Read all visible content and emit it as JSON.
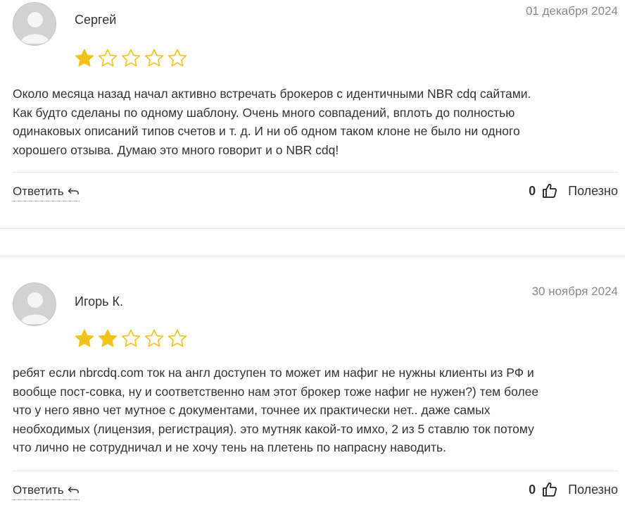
{
  "reviews": [
    {
      "author": "Сергей",
      "date": "01 декабря 2024",
      "rating": 1,
      "max_rating": 5,
      "lines": [
        "Около месяца назад начал активно встречать брокеров с идентичными NBR cdq сайтами.",
        "Как будто сделаны по одному шаблону. Очень много совпадений, вплоть до полностью",
        "одинаковых описаний типов счетов и т. д. И ни об одном таком клоне не было ни одного",
        "хорошего отзыва. Думаю это много говорит и о NBR cdq!"
      ],
      "reply_label": "Ответить",
      "helpful_count": "0",
      "helpful_label": "Полезно"
    },
    {
      "author": "Игорь К.",
      "date": "30 ноября 2024",
      "rating": 2,
      "max_rating": 5,
      "lines": [
        "ребят если nbrcdq.com ток на англ доступен то может им нафиг не нужны клиенты из РФ и",
        "вообще пост-совка, ну и соответственно нам этот брокер тоже нафиг не нужен?) тем более",
        "что у него явно чет мутное с документами, точнее их практически нет.. даже самых",
        "необходимых (лицензия, регистрация). это мутняк какой-то имхо, 2 из 5 ставлю ток потому",
        "что лично не сотрудничал и не хочу тень на плетень по напрасну наводить."
      ],
      "reply_label": "Ответить",
      "helpful_count": "0",
      "helpful_label": "Полезно"
    }
  ],
  "colors": {
    "star_filled": "#f2c21b",
    "star_empty_stroke": "#f2c21b",
    "date": "#8a8a8a",
    "avatar_bg": "#d2d2d2"
  },
  "icons": {
    "avatar": "user-avatar-placeholder-icon",
    "star": "star-icon",
    "reply": "reply-arrow-icon",
    "helpful": "thumbs-up-icon"
  }
}
